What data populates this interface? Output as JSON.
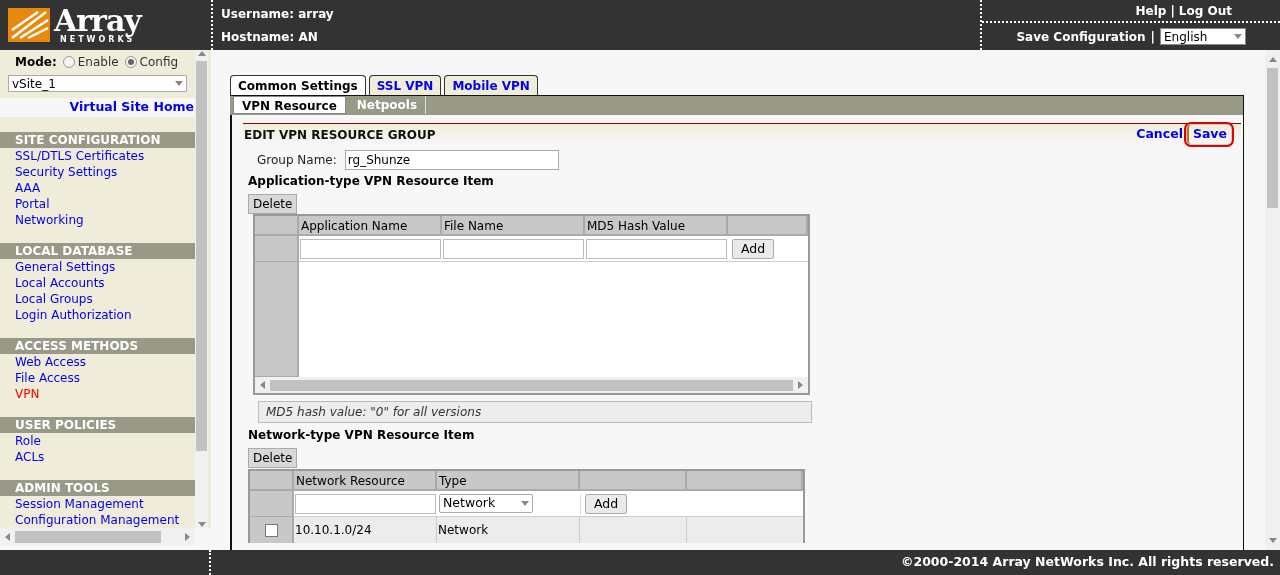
{
  "header": {
    "logo": {
      "name": "Array",
      "tagline": "NETWORKS"
    },
    "username": "Username: array",
    "hostname": "Hostname: AN",
    "links": [
      "Help",
      "Log Out"
    ],
    "separator": "|",
    "save_configuration": "Save Configuration",
    "language": "English"
  },
  "sidebar": {
    "mode_label": "Mode:",
    "modes": [
      {
        "label": "Enable",
        "selected": false
      },
      {
        "label": "Config",
        "selected": true
      }
    ],
    "site": "vSite_1",
    "home_link": "Virtual Site Home",
    "sections": [
      {
        "title": "SITE CONFIGURATION",
        "items": [
          {
            "label": "SSL/DTLS Certificates",
            "selected": false
          },
          {
            "label": "Security Settings",
            "selected": false
          },
          {
            "label": "AAA",
            "selected": false
          },
          {
            "label": "Portal",
            "selected": false
          },
          {
            "label": "Networking",
            "selected": false
          }
        ]
      },
      {
        "title": "LOCAL DATABASE",
        "items": [
          {
            "label": "General Settings",
            "selected": false
          },
          {
            "label": "Local Accounts",
            "selected": false
          },
          {
            "label": "Local Groups",
            "selected": false
          },
          {
            "label": "Login Authorization",
            "selected": false
          }
        ]
      },
      {
        "title": "ACCESS METHODS",
        "items": [
          {
            "label": "Web Access",
            "selected": false
          },
          {
            "label": "File Access",
            "selected": false
          },
          {
            "label": "VPN",
            "selected": true
          }
        ]
      },
      {
        "title": "USER POLICIES",
        "items": [
          {
            "label": "Role",
            "selected": false
          },
          {
            "label": "ACLs",
            "selected": false
          }
        ]
      },
      {
        "title": "ADMIN TOOLS",
        "items": [
          {
            "label": "Session Management",
            "selected": false
          },
          {
            "label": "Configuration Management",
            "selected": false
          }
        ]
      }
    ]
  },
  "tabs": [
    {
      "label": "Common Settings",
      "selected": true
    },
    {
      "label": "SSL VPN",
      "selected": false
    },
    {
      "label": "Mobile VPN",
      "selected": false
    }
  ],
  "subtabs": [
    {
      "label": "VPN Resource",
      "selected": true
    },
    {
      "label": "Netpools",
      "selected": false
    }
  ],
  "form": {
    "title": "EDIT VPN RESOURCE GROUP",
    "actions": [
      {
        "label": "Cancel",
        "highlighted": false
      },
      {
        "label": "Save",
        "highlighted": true
      }
    ],
    "group_name_label": "Group Name:",
    "group_name": "rg_Shunze",
    "application_section": {
      "title": "Application-type VPN Resource Item",
      "delete": "Delete",
      "columns": [
        "Application Name",
        "File Name",
        "MD5 Hash Value"
      ],
      "add": "Add",
      "note": "MD5 hash value: \"0\" for all versions"
    },
    "network_section": {
      "title": "Network-type VPN Resource Item",
      "delete": "Delete",
      "columns": [
        "Network Resource",
        "Type"
      ],
      "type_value": "Network",
      "add": "Add",
      "rows": [
        {
          "checked": false,
          "cells": [
            "10.10.1.0/24",
            "Network"
          ]
        }
      ]
    }
  },
  "footer": "©2000-2014 Array NetWorks Inc. All rights reserved."
}
